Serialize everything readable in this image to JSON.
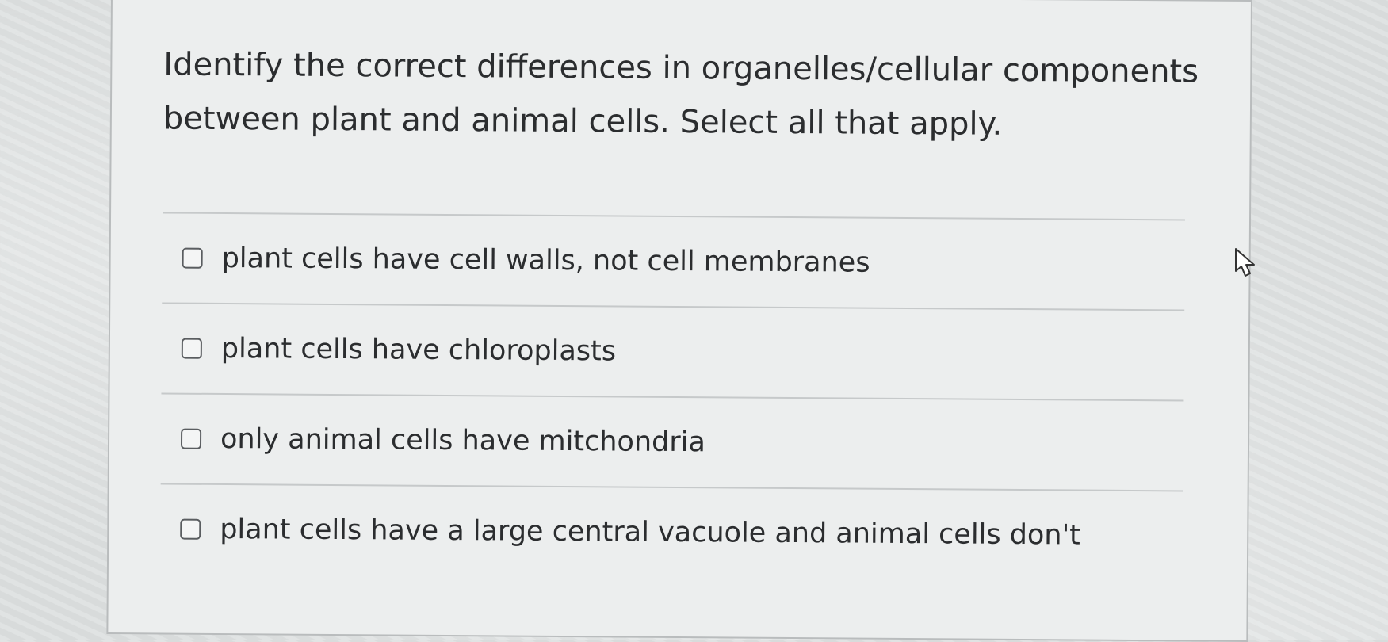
{
  "question": {
    "text": "Identify the correct differences in organelles/cellular components between plant and animal cells. Select all that apply."
  },
  "options": [
    {
      "label": "plant cells have cell walls, not cell membranes",
      "checked": false
    },
    {
      "label": "plant cells have chloroplasts",
      "checked": false
    },
    {
      "label": "only animal cells have mitchondria",
      "checked": false
    },
    {
      "label": "plant cells have a large central vacuole and animal cells don't",
      "checked": false
    }
  ],
  "cursor": {
    "icon": "pointer-cursor-icon"
  }
}
